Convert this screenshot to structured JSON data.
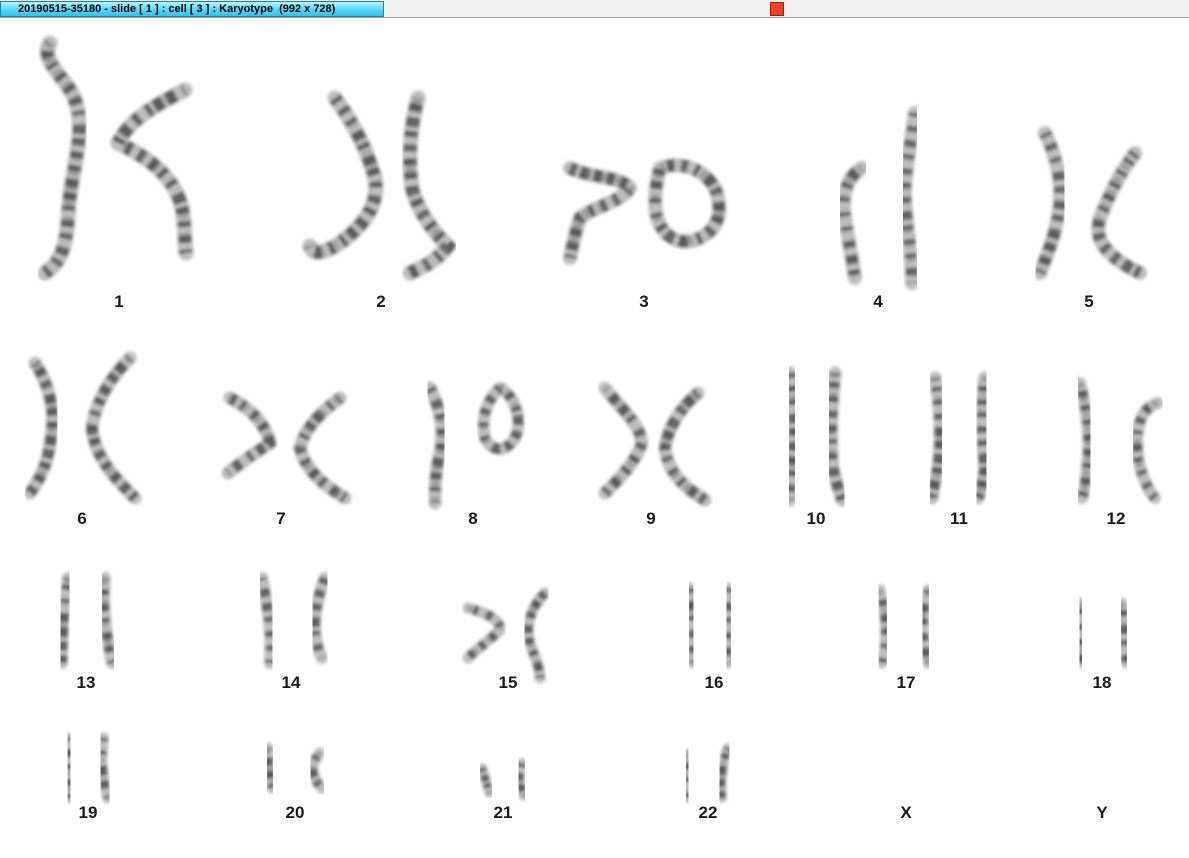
{
  "window": {
    "title": "20190515-35180 - slide [ 1 ] : cell [ 3 ] : Karyotype  (992 x 728)"
  },
  "karyotype": {
    "labels": [
      "1",
      "2",
      "3",
      "4",
      "5",
      "6",
      "7",
      "8",
      "9",
      "10",
      "11",
      "12",
      "13",
      "14",
      "15",
      "16",
      "17",
      "18",
      "19",
      "20",
      "21",
      "22",
      "X",
      "Y"
    ]
  },
  "colors": {
    "chromosome_dark": "#3a3a3a",
    "chromosome_light": "#bdbdbd",
    "accent": "#4fd8f6"
  }
}
